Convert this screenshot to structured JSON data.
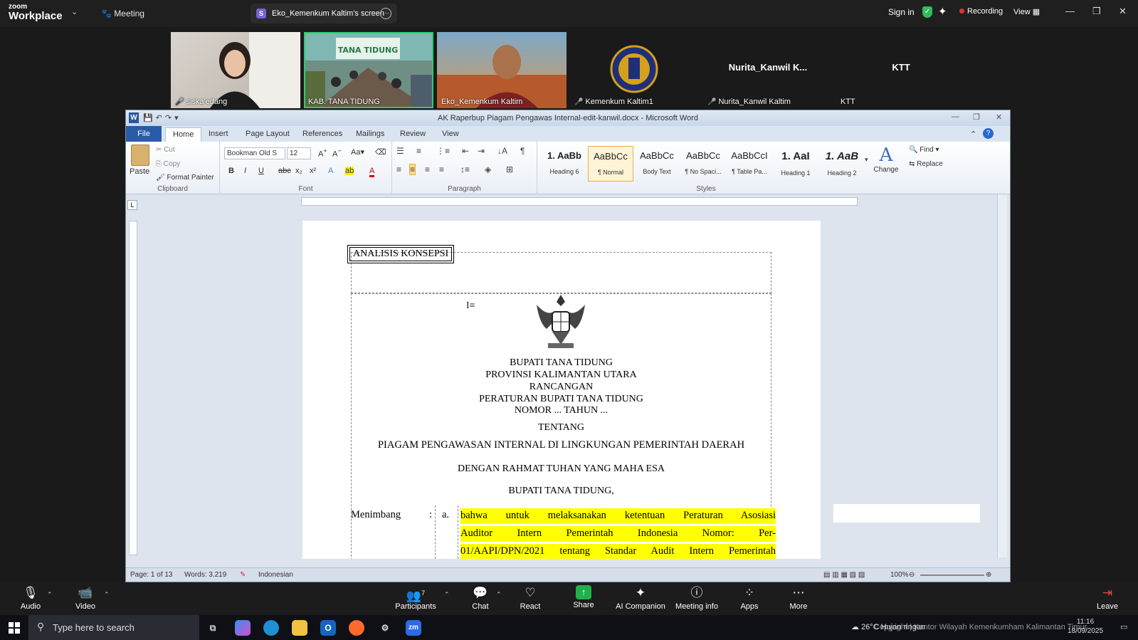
{
  "zoom": {
    "logo_line1": "zoom",
    "logo_line2": "Workplace",
    "meeting_label": "Meeting",
    "share_badge": "S",
    "share_title": "Eko_Kemenkum Kaltim's screen",
    "sign_in": "Sign in",
    "recording": "Recording",
    "view": "View",
    "record_color": "#e0322f",
    "accent_color": "#2ecc71"
  },
  "gallery": {
    "participants": [
      {
        "name": "siska'edang",
        "muted": true,
        "active": false,
        "big": ""
      },
      {
        "name": "KAB. TANA TIDUNG",
        "muted": false,
        "active": true,
        "big": ""
      },
      {
        "name": "Eko_Kemenkum Kaltim",
        "muted": false,
        "active": false,
        "big": ""
      },
      {
        "name": "Kemenkum Kaltim1",
        "muted": true,
        "active": false,
        "big": ""
      },
      {
        "name": "Nurita_Kanwil Kaltim",
        "muted": true,
        "active": false,
        "big": "Nurita_Kanwil  K..."
      },
      {
        "name": "KTT",
        "muted": false,
        "active": false,
        "big": "KTT"
      }
    ],
    "video_banner": "TANA TIDUNG"
  },
  "word": {
    "title": "AK Raperbup Piagam Pengawas Internal-edit-kanwil.docx  -  Microsoft Word",
    "app_icon": "W",
    "tabs": [
      "File",
      "Home",
      "Insert",
      "Page Layout",
      "References",
      "Mailings",
      "Review",
      "View"
    ],
    "clipboard": {
      "paste": "Paste",
      "cut": "Cut",
      "copy": "Copy",
      "format_painter": "Format Painter",
      "group": "Clipboard"
    },
    "font": {
      "name": "Bookman Old S",
      "size": "12",
      "group": "Font"
    },
    "paragraph": {
      "group": "Paragraph"
    },
    "styles": [
      {
        "preview": "1.  AaBb",
        "name": "Heading 6",
        "selected": false
      },
      {
        "preview": "AaBbCc",
        "name": "¶ Normal",
        "selected": true
      },
      {
        "preview": "AaBbCc",
        "name": "Body Text",
        "selected": false
      },
      {
        "preview": "AaBbCc",
        "name": "¶ No Spaci...",
        "selected": false
      },
      {
        "preview": "AaBbCcI",
        "name": "¶ Table Pa...",
        "selected": false
      },
      {
        "preview": "1.  AaI",
        "name": "Heading 1",
        "selected": false
      },
      {
        "preview": "1.  AaB",
        "name": "Heading 2",
        "selected": false
      }
    ],
    "styles_group": "Styles",
    "change_styles": "Change",
    "find": "Find",
    "replace": "Replace",
    "ruler_tab": "L",
    "status": {
      "page": "Page: 1 of 13",
      "words": "Words: 3.219",
      "language": "Indonesian",
      "zoom": "100%",
      "zoom_level": 1.0
    }
  },
  "document": {
    "box_label": "ANALISIS KONSEPSI",
    "lines": [
      "BUPATI TANA TIDUNG",
      "PROVINSI KALIMANTAN UTARA",
      "RANCANGAN",
      "PERATURAN BUPATI TANA TIDUNG",
      "NOMOR ... TAHUN ...",
      "TENTANG",
      "PIAGAM PENGAWASAN INTERNAL DI LINGKUNGAN PEMERINTAH DAERAH",
      "DENGAN RAHMAT TUHAN YANG MAHA ESA",
      "BUPATI TANA TIDUNG,"
    ],
    "menimbang": "Menimbang",
    "colon": ":",
    "item": "a.",
    "highlighted": [
      "bahwa untuk melaksanakan ketentuan Peraturan Asosiasi",
      "Auditor Intern Pemerintah Indonesia Nomor: Per-",
      "01/AAPI/DPN/2021 tentang Standar Audit Intern Pemerintah"
    ],
    "highlight_color": "#ffff00"
  },
  "controls": {
    "audio": "Audio",
    "video": "Video",
    "participants": "Participants",
    "participants_count": "7",
    "chat": "Chat",
    "react": "React",
    "share": "Share",
    "ai": "AI Companion",
    "info": "Meeting info",
    "apps": "Apps",
    "more": "More",
    "leave": "Leave"
  },
  "taskbar": {
    "search_placeholder": "Type here to search",
    "weather": "26°C  Hujan ringan",
    "watermark": "Copyright | Kantor Wilayah Kemenkumham Kalimantan Timur",
    "time": "11:16",
    "date": "18/09/2025"
  }
}
